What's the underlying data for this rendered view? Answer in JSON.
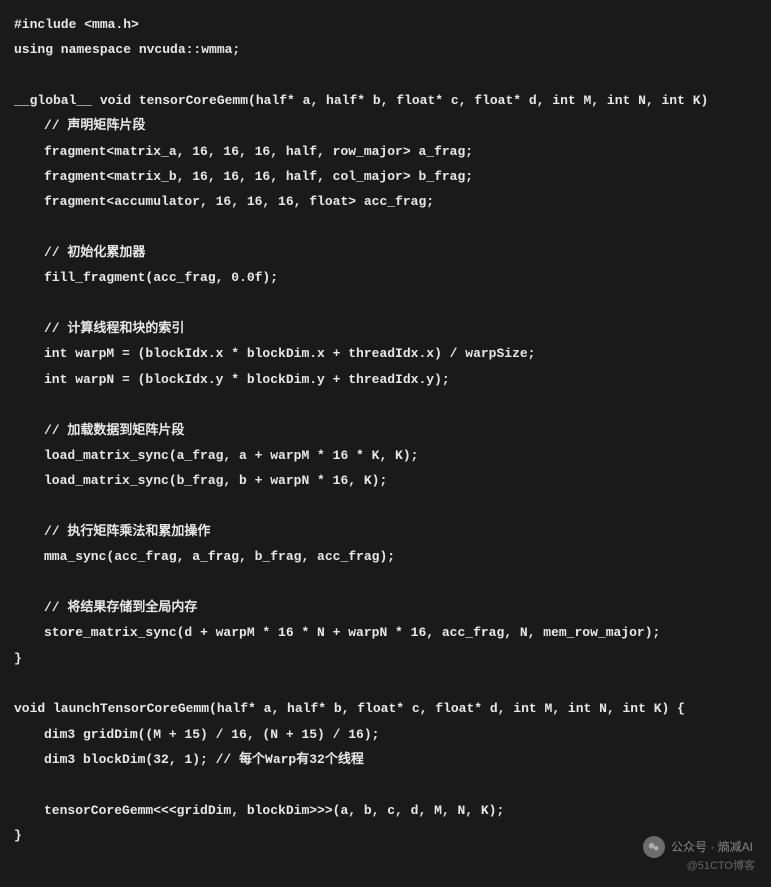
{
  "code": {
    "lines": [
      {
        "text": "#include <mma.h>",
        "indent": 0
      },
      {
        "text": "using namespace nvcuda::wmma;",
        "indent": 0
      },
      {
        "text": "",
        "indent": 0
      },
      {
        "text": "__global__ void tensorCoreGemm(half* a, half* b, float* c, float* d, int M, int N, int K)",
        "indent": 0
      },
      {
        "text": "// 声明矩阵片段",
        "indent": 1
      },
      {
        "text": "fragment<matrix_a, 16, 16, 16, half, row_major> a_frag;",
        "indent": 1
      },
      {
        "text": "fragment<matrix_b, 16, 16, 16, half, col_major> b_frag;",
        "indent": 1
      },
      {
        "text": "fragment<accumulator, 16, 16, 16, float> acc_frag;",
        "indent": 1
      },
      {
        "text": "",
        "indent": 0
      },
      {
        "text": "// 初始化累加器",
        "indent": 1
      },
      {
        "text": "fill_fragment(acc_frag, 0.0f);",
        "indent": 1
      },
      {
        "text": "",
        "indent": 0
      },
      {
        "text": "// 计算线程和块的索引",
        "indent": 1
      },
      {
        "text": "int warpM = (blockIdx.x * blockDim.x + threadIdx.x) / warpSize;",
        "indent": 1
      },
      {
        "text": "int warpN = (blockIdx.y * blockDim.y + threadIdx.y);",
        "indent": 1
      },
      {
        "text": "",
        "indent": 0
      },
      {
        "text": "// 加载数据到矩阵片段",
        "indent": 1
      },
      {
        "text": "load_matrix_sync(a_frag, a + warpM * 16 * K, K);",
        "indent": 1
      },
      {
        "text": "load_matrix_sync(b_frag, b + warpN * 16, K);",
        "indent": 1
      },
      {
        "text": "",
        "indent": 0
      },
      {
        "text": "// 执行矩阵乘法和累加操作",
        "indent": 1
      },
      {
        "text": "mma_sync(acc_frag, a_frag, b_frag, acc_frag);",
        "indent": 1
      },
      {
        "text": "",
        "indent": 0
      },
      {
        "text": "// 将结果存储到全局内存",
        "indent": 1
      },
      {
        "text": "store_matrix_sync(d + warpM * 16 * N + warpN * 16, acc_frag, N, mem_row_major);",
        "indent": 1
      },
      {
        "text": "}",
        "indent": 0
      },
      {
        "text": "",
        "indent": 0
      },
      {
        "text": "void launchTensorCoreGemm(half* a, half* b, float* c, float* d, int M, int N, int K) {",
        "indent": 0
      },
      {
        "text": "dim3 gridDim((M + 15) / 16, (N + 15) / 16);",
        "indent": 1
      },
      {
        "text": "dim3 blockDim(32, 1); // 每个Warp有32个线程",
        "indent": 1
      },
      {
        "text": "",
        "indent": 0
      },
      {
        "text": "tensorCoreGemm<<<gridDim, blockDim>>>(a, b, c, d, M, N, K);",
        "indent": 1
      },
      {
        "text": "}",
        "indent": 0
      }
    ]
  },
  "watermark": {
    "prefix": "公众号 · ",
    "name": "熵减AI"
  },
  "credit": "@51CTO博客"
}
